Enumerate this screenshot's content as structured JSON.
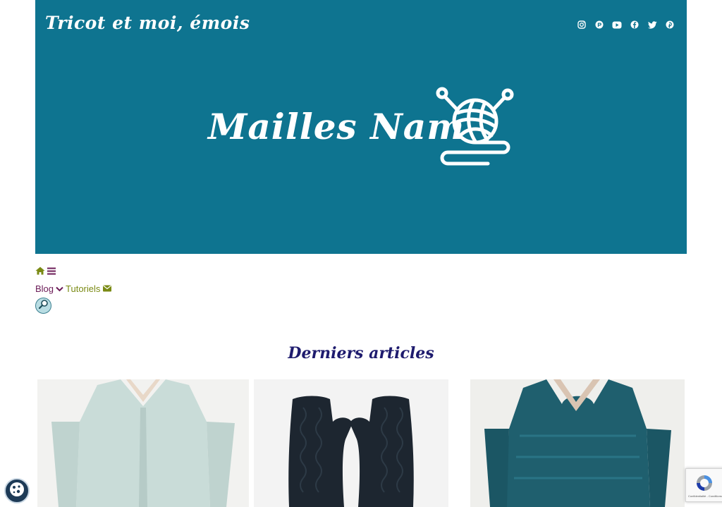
{
  "site": {
    "title": "Tricot et moi, émois",
    "logo_text": "Mailles Nam"
  },
  "colors": {
    "header_bg": "#0e7490",
    "accent_green": "#7a8a14",
    "accent_plum": "#6b1b57",
    "title_navy": "#1e1b6e"
  },
  "socials": [
    {
      "icon": "instagram-icon"
    },
    {
      "icon": "ravelry-icon"
    },
    {
      "icon": "youtube-icon"
    },
    {
      "icon": "facebook-icon"
    },
    {
      "icon": "twitter-icon"
    },
    {
      "icon": "pinterest-icon"
    }
  ],
  "nav": {
    "home_icon": "home-icon",
    "menu_icon": "hamburger-icon",
    "blog_label": "Blog",
    "tutorials_label": "Tutoriels",
    "mail_icon": "envelope-icon",
    "search_icon": "magnifier-icon"
  },
  "main": {
    "section_title": "Derniers articles"
  },
  "widgets": {
    "cookie_icon": "cookie-icon",
    "recaptcha_text": "Confidentialité - Conditions"
  }
}
